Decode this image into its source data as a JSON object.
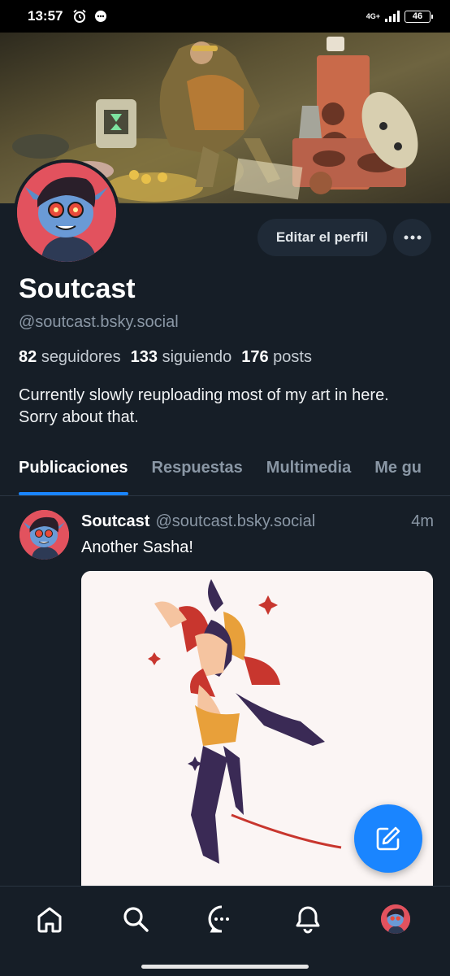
{
  "status_bar": {
    "time": "13:57",
    "network": "4G+",
    "battery": "46"
  },
  "profile": {
    "display_name": "Soutcast",
    "handle": "@soutcast.bsky.social",
    "edit_label": "Editar el perfil",
    "more_label": "···",
    "followers_count": "82",
    "followers_label": "seguidores",
    "following_count": "133",
    "following_label": "siguiendo",
    "posts_count": "176",
    "posts_label": "posts",
    "bio": "Currently slowly reuploading most of my art in here. Sorry about that."
  },
  "tabs": [
    {
      "label": "Publicaciones"
    },
    {
      "label": "Respuestas"
    },
    {
      "label": "Multimedia"
    },
    {
      "label": "Me gu"
    }
  ],
  "post": {
    "author": "Soutcast",
    "handle": "@soutcast.bsky.social",
    "time": "4m",
    "text": "Another Sasha!"
  },
  "nav": {
    "items": [
      "home-icon",
      "search-icon",
      "chat-icon",
      "bell-icon",
      "profile-avatar"
    ]
  },
  "colors": {
    "accent": "#1a85ff",
    "background": "#161e27",
    "avatar_bg": "#e2525e"
  }
}
